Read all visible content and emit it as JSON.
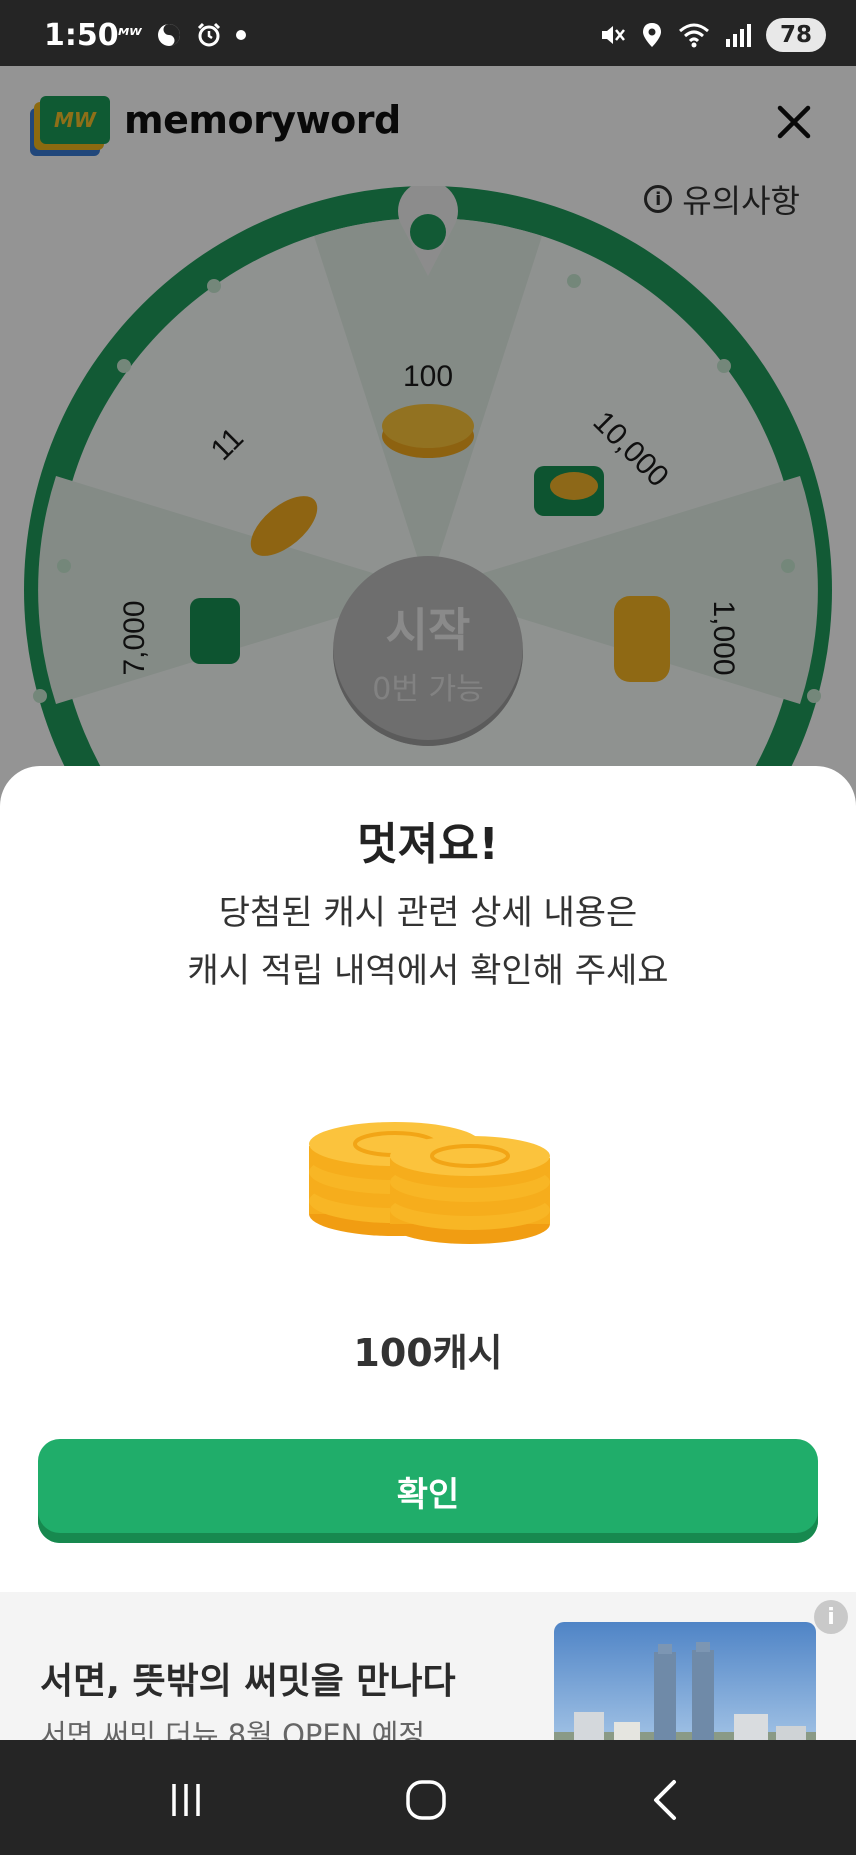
{
  "status_bar": {
    "time": "1:50",
    "left_icons": [
      "mw-icon",
      "swirl-icon",
      "alarm-icon",
      "dot-icon"
    ],
    "right_icons": [
      "mute-icon",
      "location-icon",
      "wifi-icon",
      "signal-icon"
    ],
    "battery": "78"
  },
  "app": {
    "logo_badge": "MW",
    "logo_text": "memoryword",
    "notice_label": "유의사항",
    "wheel": {
      "segments": [
        "100",
        "10,000",
        "1,000",
        "7,000",
        "11"
      ],
      "start_title": "시작",
      "start_subtitle": "0번 가능",
      "colors": {
        "ring": "#1f9b5c",
        "segment_light": "#eef6f0"
      }
    }
  },
  "sheet": {
    "title": "멋져요!",
    "description_line1": "당첨된 캐시 관련 상세 내용은",
    "description_line2": "캐시 적립 내역에서 확인해 주세요",
    "amount": "100캐시",
    "confirm_label": "확인",
    "accent_color": "#20ad6a"
  },
  "ad": {
    "title": "서면, 뜻밖의 써밋을 만나다",
    "subtitle": "서면 써밋 더뉴 8월 OPEN 예정",
    "info_icon": "i"
  },
  "nav": {
    "buttons": [
      "recent-apps-icon",
      "home-icon",
      "back-icon"
    ]
  }
}
